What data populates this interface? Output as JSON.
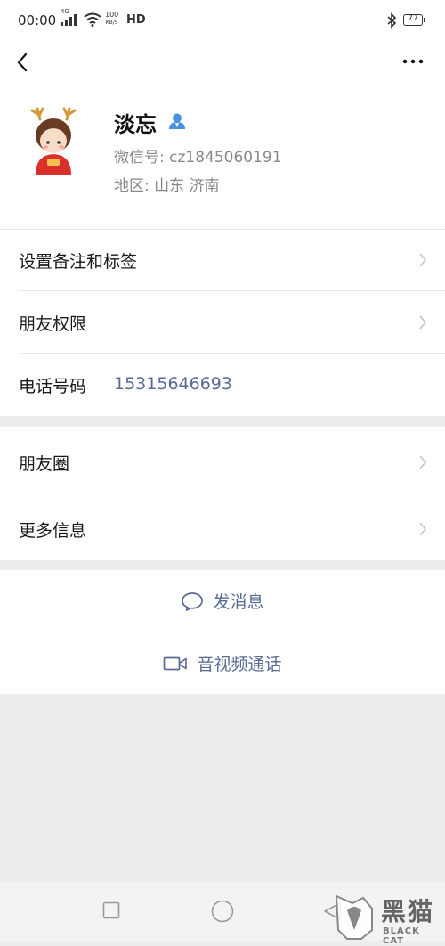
{
  "status_bar": {
    "time": "00:00",
    "network": "4G",
    "speed_value": "100",
    "speed_unit": "KB/S",
    "hd": "HD",
    "battery": "77"
  },
  "profile": {
    "name": "淡忘",
    "wechat_id": "微信号: cz1845060191",
    "region": "地区: 山东  济南"
  },
  "menu": {
    "remark_tags": "设置备注和标签",
    "friend_permissions": "朋友权限",
    "phone_label": "电话号码",
    "phone_value": "15315646693",
    "moments": "朋友圈",
    "more_info": "更多信息"
  },
  "actions": {
    "send_message": "发消息",
    "av_call": "音视频通话"
  },
  "watermark": {
    "main": "黑猫",
    "sub": "BLACK CAT"
  },
  "colors": {
    "link": "#576b95",
    "background": "#ededed",
    "badge": "#4a90e2"
  }
}
